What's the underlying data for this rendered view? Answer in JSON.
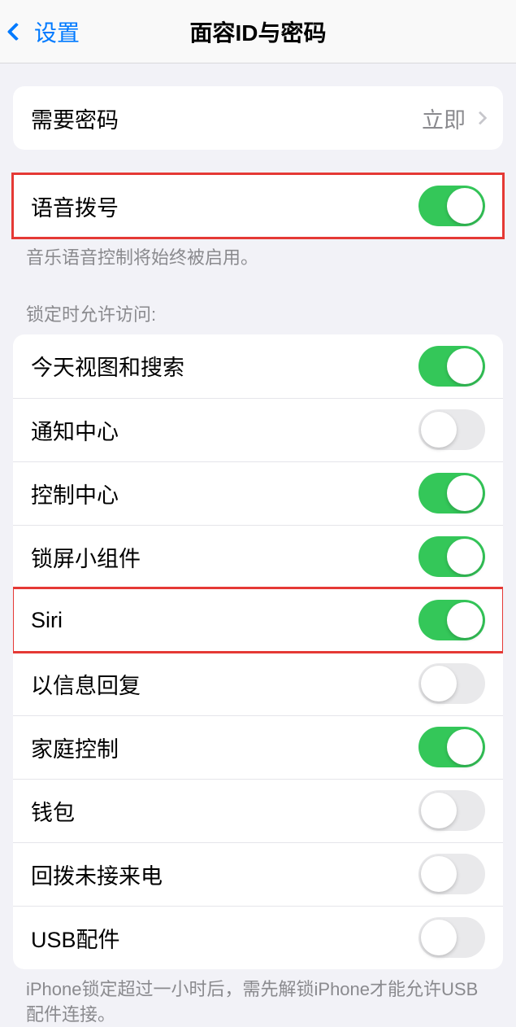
{
  "nav": {
    "back_label": "设置",
    "title": "面容ID与密码"
  },
  "require_passcode": {
    "label": "需要密码",
    "value": "立即"
  },
  "voice_dial": {
    "label": "语音拨号",
    "on": true,
    "footer": "音乐语音控制将始终被启用。"
  },
  "allow_access_header": "锁定时允许访问:",
  "allow_access_items": [
    {
      "label": "今天视图和搜索",
      "on": true
    },
    {
      "label": "通知中心",
      "on": false
    },
    {
      "label": "控制中心",
      "on": true
    },
    {
      "label": "锁屏小组件",
      "on": true
    },
    {
      "label": "Siri",
      "on": true
    },
    {
      "label": "以信息回复",
      "on": false
    },
    {
      "label": "家庭控制",
      "on": true
    },
    {
      "label": "钱包",
      "on": false
    },
    {
      "label": "回拨未接来电",
      "on": false
    },
    {
      "label": "USB配件",
      "on": false
    }
  ],
  "usb_footer": "iPhone锁定超过一小时后，需先解锁iPhone才能允许USB配件连接。"
}
